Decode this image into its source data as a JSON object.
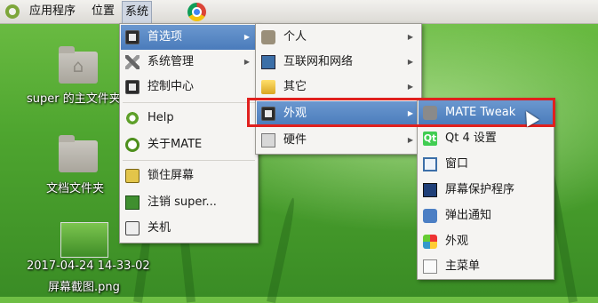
{
  "top_panel": {
    "app_menu": "应用程序",
    "places_menu": "位置",
    "system_menu": "系统"
  },
  "desktop": {
    "icons": [
      {
        "label": "super 的主文件夹"
      },
      {
        "label": "文档文件夹"
      },
      {
        "label": "2017-04-24 14-33-02",
        "label2": "屏幕截图.png"
      }
    ]
  },
  "system_menu": {
    "items": [
      {
        "label": "首选项"
      },
      {
        "label": "系统管理"
      },
      {
        "label": "控制中心"
      },
      {
        "label": "Help"
      },
      {
        "label": "关于MATE"
      },
      {
        "label": "锁住屏幕"
      },
      {
        "label": "注销 super..."
      },
      {
        "label": "关机"
      }
    ]
  },
  "preferences_menu": {
    "items": [
      {
        "label": "个人"
      },
      {
        "label": "互联网和网络"
      },
      {
        "label": "其它"
      },
      {
        "label": "外观"
      },
      {
        "label": "硬件"
      }
    ]
  },
  "appearance_menu": {
    "items": [
      {
        "label": "MATE Tweak"
      },
      {
        "label": "Qt 4 设置"
      },
      {
        "label": "窗口"
      },
      {
        "label": "屏幕保护程序"
      },
      {
        "label": "弹出通知"
      },
      {
        "label": "外观"
      },
      {
        "label": "主菜单"
      }
    ]
  },
  "colors": {
    "highlight_blue": "#4a7bbb",
    "annotation_red": "#e0201e"
  }
}
